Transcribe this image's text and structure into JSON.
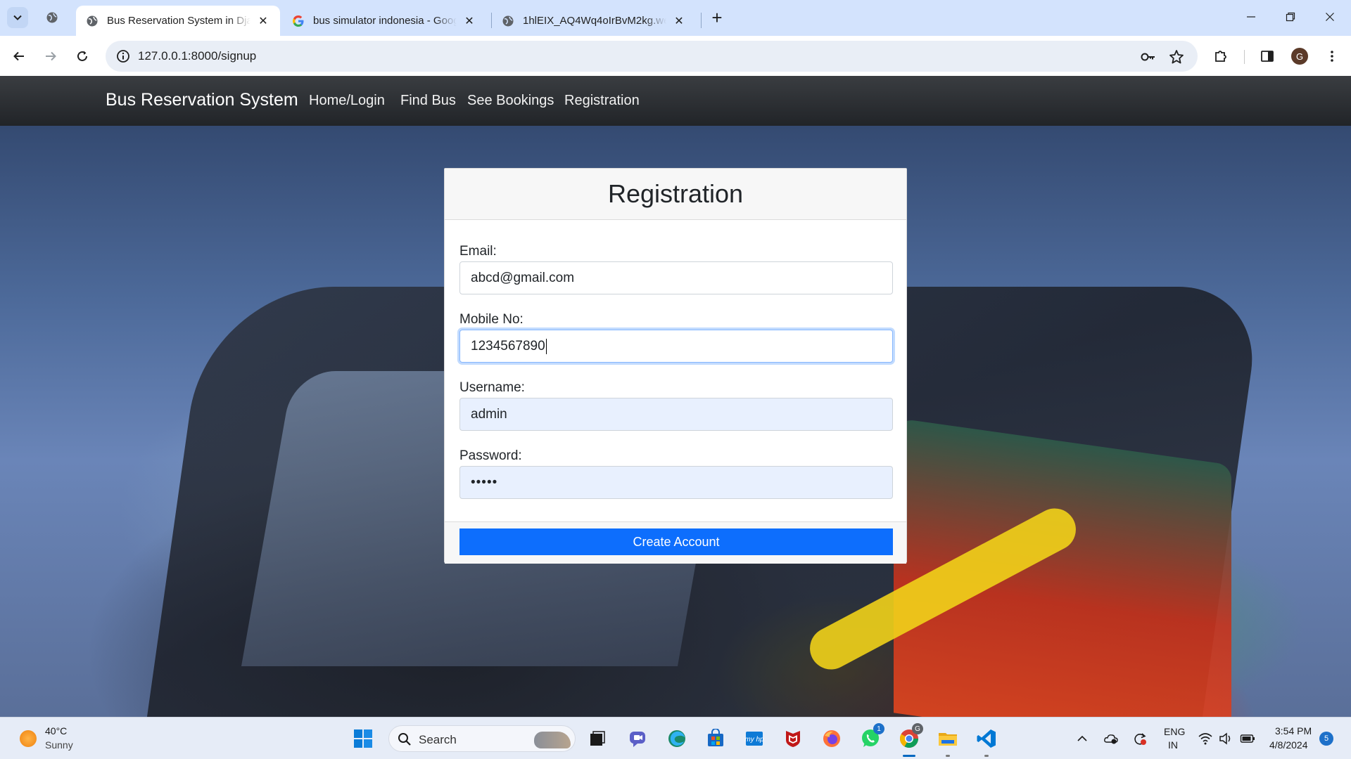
{
  "browser": {
    "tabs": [
      {
        "title": "Bus Reservation System in Django",
        "active": true
      },
      {
        "title": "bus simulator indonesia - Google Search",
        "active": false
      },
      {
        "title": "1hlEIX_AQ4Wq4oIrBvM2kg.webp",
        "active": false
      }
    ],
    "close_glyph": "✕",
    "new_tab_glyph": "+",
    "url": "127.0.0.1:8000/signup",
    "profile_initial": "G"
  },
  "navbar": {
    "brand": "Bus Reservation System",
    "links": [
      "Home/Login",
      "Find Bus",
      "See Bookings",
      "Registration"
    ]
  },
  "form": {
    "title": "Registration",
    "email_label": "Email:",
    "email_value": "abcd@gmail.com",
    "mobile_label": "Mobile No:",
    "mobile_value": "1234567890",
    "username_label": "Username:",
    "username_value": "admin",
    "password_label": "Password:",
    "password_value": "•••••",
    "submit_label": "Create Account"
  },
  "taskbar": {
    "weather_temp": "40°C",
    "weather_condition": "Sunny",
    "search_placeholder": "Search",
    "whatsapp_badge": "1",
    "chrome_badge": "G",
    "language_top": "ENG",
    "language_bottom": "IN",
    "time": "3:54 PM",
    "date": "4/8/2024",
    "notification_count": "5"
  },
  "colors": {
    "tabbar_bg": "#d3e3fd",
    "navbar_bg": "#212529",
    "primary_button": "#0d6efd",
    "autofill_bg": "#e8f0fe"
  }
}
